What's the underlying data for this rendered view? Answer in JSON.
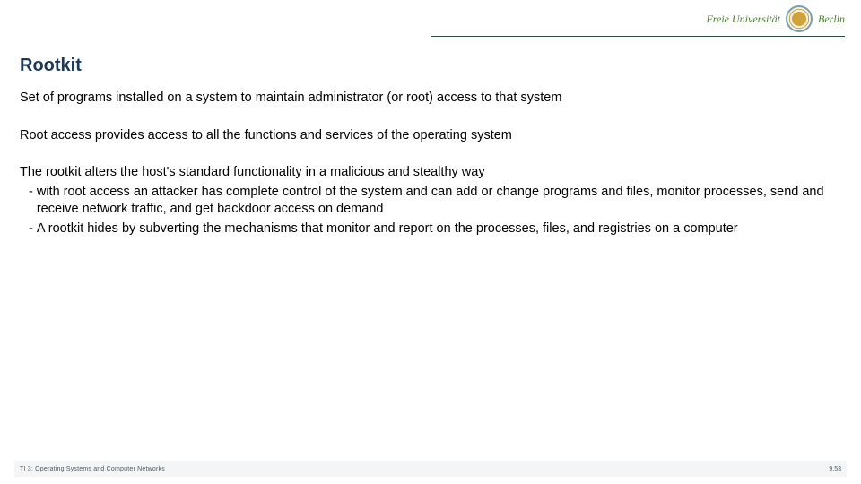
{
  "header": {
    "uni_left": "Freie Universität",
    "uni_right": "Berlin"
  },
  "title": "Rootkit",
  "body": {
    "p1": "Set of programs installed on a system to maintain administrator (or root) access to that system",
    "p2": "Root access provides access to all the functions and services of the operating system",
    "p3": "The rootkit alters the host's standard functionality in a malicious and stealthy way",
    "sub1": "with root access an attacker has complete control of the system and can add or change programs and files, monitor processes, send and receive network traffic, and get backdoor access on demand",
    "sub2": "A rootkit hides by subverting the mechanisms that monitor and report on the processes, files, and registries on a computer"
  },
  "footer": {
    "left": "TI 3: Operating Systems and Computer Networks",
    "right": "9.53"
  }
}
